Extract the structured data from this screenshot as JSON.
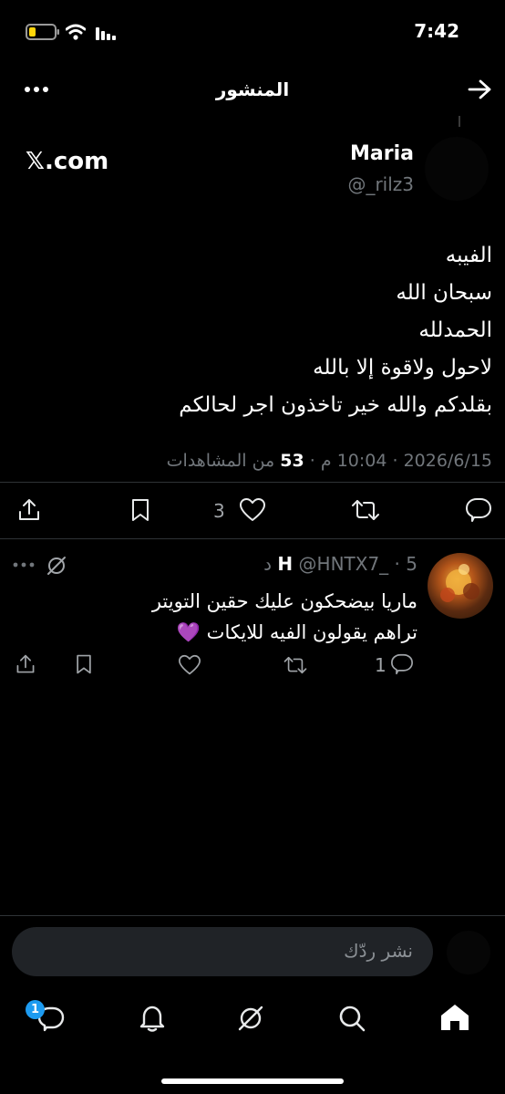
{
  "status_bar": {
    "time": "7:42"
  },
  "header": {
    "title": "المنشور"
  },
  "post": {
    "author_name": "Maria",
    "author_handle": "@_rilz3",
    "brand": "𝕏.com",
    "text": "الفيبه\nسبحان الله\nالحمدلله\nلاحول ولاقوة إلا بالله\nبقلدكم والله خير تاخذون اجر لحالكم",
    "date": "2026/6/15",
    "time": "10:04 م",
    "views_count": "53",
    "views_label": "من المشاهدات",
    "likes_count": "3"
  },
  "reply": {
    "author_name": "H",
    "author_handle": "@HNTX7_",
    "time_ago": "5 د",
    "text": "ماريا بيضحكون عليك حقين التويتر\nتراهم يقولون الفيه للايكات 💜",
    "reply_count": "1"
  },
  "composer": {
    "placeholder": "نشر ردّك"
  },
  "bottom_nav": {
    "messages_badge": "1"
  }
}
